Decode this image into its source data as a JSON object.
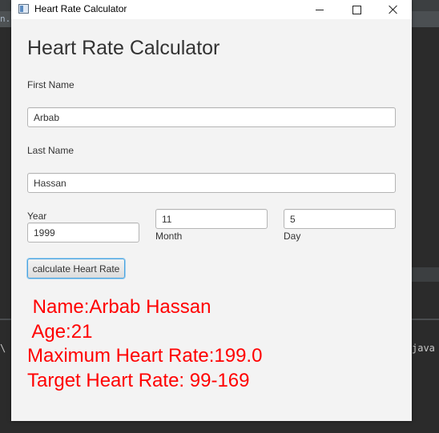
{
  "background": {
    "editor_tab_fragment": "n.j",
    "console_left_fragment": "\\",
    "console_right_fragment": "java"
  },
  "window": {
    "title": "Heart Rate Calculator"
  },
  "form": {
    "heading": "Heart Rate Calculator",
    "first_name_label": "First Name",
    "first_name_value": "Arbab",
    "last_name_label": "Last Name",
    "last_name_value": "Hassan",
    "year_label": "Year",
    "year_value": "1999",
    "month_label": "Month",
    "month_value": "11",
    "day_label": "Day",
    "day_value": "5",
    "calculate_button": "calculate Heart Rate"
  },
  "results": {
    "name_line": " Name:Arbab Hassan",
    "age_line": " Age:21",
    "max_hr_line": "Maximum Heart Rate:199.0",
    "target_hr_line": "Target Heart Rate: 99-169",
    "color": "#ff0000"
  },
  "colors": {
    "window_bg": "#f3f3f3",
    "ide_bg": "#2b2b2b",
    "button_focus_border": "#4aa3df"
  }
}
